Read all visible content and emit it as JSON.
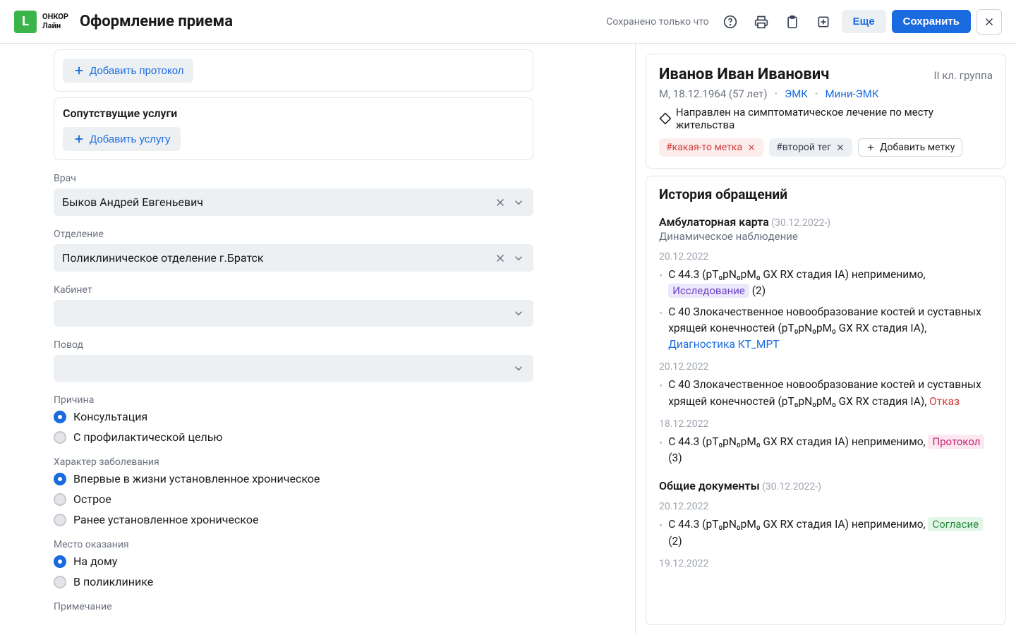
{
  "header": {
    "logo_letter": "L",
    "logo_line1": "ОНКОР",
    "logo_line2": "Лайн",
    "page_title": "Оформление приема",
    "saved_text": "Сохранено только что",
    "more_btn": "Еще",
    "save_btn": "Сохранить"
  },
  "form": {
    "add_protocol": "Добавить протокол",
    "related_services_title": "Сопутствущие услуги",
    "add_service": "Добавить услугу",
    "doctor_label": "Врач",
    "doctor_value": "Быков Андрей Евгеньевич",
    "department_label": "Отделение",
    "department_value": "Поликлиническое отделение г.Братск",
    "room_label": "Кабинет",
    "reason_visit_label": "Повод",
    "cause_label": "Причина",
    "cause_options": [
      "Консультация",
      "С профилактической целью"
    ],
    "disease_label": "Характер заболевания",
    "disease_options": [
      "Впервые в жизни установленное хроническое",
      "Острое",
      "Ранее установленное хроническое"
    ],
    "place_label": "Место оказания",
    "place_options": [
      "На дому",
      "В поликлинике"
    ],
    "note_label": "Примечание"
  },
  "patient": {
    "name": "Иванов Иван Иванович",
    "group": "II кл. группа",
    "meta": "М, 18.12.1964 (57 лет)",
    "link1": "ЭМК",
    "link2": "Мини-ЭМК",
    "direction": "Направлен на симптоматическое лечение по месту жительства",
    "tag1": "#какая-то метка",
    "tag2": "#второй тег",
    "add_tag": "Добавить метку"
  },
  "history": {
    "title": "История обращений",
    "amb_title": "Амбулаторная карта",
    "amb_range": "(30.12.2022-)",
    "amb_sub": "Динамическое наблюдение",
    "entries": [
      {
        "date": "20.12.2022",
        "items": [
          {
            "text_before": "C 44.3 (pT₀pN₀pM₀ GX RX стадия IA) неприменимо, ",
            "badge": "Исследование",
            "badge_class": "badge-purple",
            "count_after": " (2)"
          },
          {
            "text_before": "C 40 Злокачественное новообразование костей и суставных хрящей конечностей (pT₀pN₀pM₀ GX RX стадия IA), ",
            "link": "Диагностика КТ_МРТ"
          }
        ]
      },
      {
        "date": "20.12.2022",
        "items": [
          {
            "text_before": "C 40 Злокачественное новообразование костей и суставных хрящей конечностей (pT₀pN₀pM₀ GX RX стадия IA), ",
            "red": "Отказ"
          }
        ]
      },
      {
        "date": "18.12.2022",
        "items": [
          {
            "text_before": "C 44.3 (pT₀pN₀pM₀ GX RX стадия IA) неприменимо, ",
            "badge": "Протокол",
            "badge_class": "badge-pink",
            "count_after": " (3)"
          }
        ]
      }
    ],
    "docs_title": "Общие документы",
    "docs_range": "(30.12.2022-)",
    "docs_entries": [
      {
        "date": "20.12.2022",
        "items": [
          {
            "text_before": "C 44.3 (pT₀pN₀pM₀ GX RX стадия IA) неприменимо, ",
            "badge": "Согласие",
            "badge_class": "badge-green",
            "count_after": " (2)"
          }
        ]
      },
      {
        "date": "19.12.2022",
        "items": []
      }
    ]
  }
}
